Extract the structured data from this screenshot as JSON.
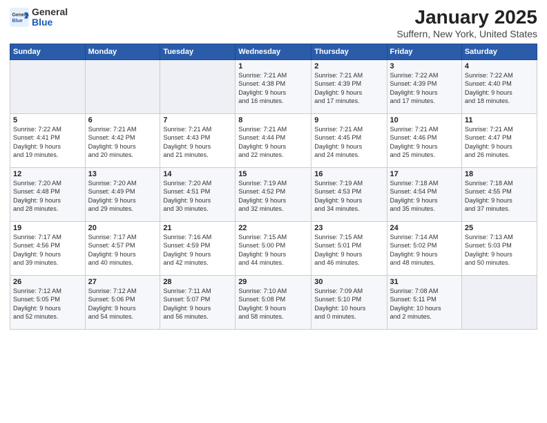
{
  "header": {
    "logo_general": "General",
    "logo_blue": "Blue",
    "title": "January 2025",
    "subtitle": "Suffern, New York, United States"
  },
  "weekdays": [
    "Sunday",
    "Monday",
    "Tuesday",
    "Wednesday",
    "Thursday",
    "Friday",
    "Saturday"
  ],
  "weeks": [
    [
      {
        "day": "",
        "info": ""
      },
      {
        "day": "",
        "info": ""
      },
      {
        "day": "",
        "info": ""
      },
      {
        "day": "1",
        "info": "Sunrise: 7:21 AM\nSunset: 4:38 PM\nDaylight: 9 hours\nand 16 minutes."
      },
      {
        "day": "2",
        "info": "Sunrise: 7:21 AM\nSunset: 4:39 PM\nDaylight: 9 hours\nand 17 minutes."
      },
      {
        "day": "3",
        "info": "Sunrise: 7:22 AM\nSunset: 4:39 PM\nDaylight: 9 hours\nand 17 minutes."
      },
      {
        "day": "4",
        "info": "Sunrise: 7:22 AM\nSunset: 4:40 PM\nDaylight: 9 hours\nand 18 minutes."
      }
    ],
    [
      {
        "day": "5",
        "info": "Sunrise: 7:22 AM\nSunset: 4:41 PM\nDaylight: 9 hours\nand 19 minutes."
      },
      {
        "day": "6",
        "info": "Sunrise: 7:21 AM\nSunset: 4:42 PM\nDaylight: 9 hours\nand 20 minutes."
      },
      {
        "day": "7",
        "info": "Sunrise: 7:21 AM\nSunset: 4:43 PM\nDaylight: 9 hours\nand 21 minutes."
      },
      {
        "day": "8",
        "info": "Sunrise: 7:21 AM\nSunset: 4:44 PM\nDaylight: 9 hours\nand 22 minutes."
      },
      {
        "day": "9",
        "info": "Sunrise: 7:21 AM\nSunset: 4:45 PM\nDaylight: 9 hours\nand 24 minutes."
      },
      {
        "day": "10",
        "info": "Sunrise: 7:21 AM\nSunset: 4:46 PM\nDaylight: 9 hours\nand 25 minutes."
      },
      {
        "day": "11",
        "info": "Sunrise: 7:21 AM\nSunset: 4:47 PM\nDaylight: 9 hours\nand 26 minutes."
      }
    ],
    [
      {
        "day": "12",
        "info": "Sunrise: 7:20 AM\nSunset: 4:48 PM\nDaylight: 9 hours\nand 28 minutes."
      },
      {
        "day": "13",
        "info": "Sunrise: 7:20 AM\nSunset: 4:49 PM\nDaylight: 9 hours\nand 29 minutes."
      },
      {
        "day": "14",
        "info": "Sunrise: 7:20 AM\nSunset: 4:51 PM\nDaylight: 9 hours\nand 30 minutes."
      },
      {
        "day": "15",
        "info": "Sunrise: 7:19 AM\nSunset: 4:52 PM\nDaylight: 9 hours\nand 32 minutes."
      },
      {
        "day": "16",
        "info": "Sunrise: 7:19 AM\nSunset: 4:53 PM\nDaylight: 9 hours\nand 34 minutes."
      },
      {
        "day": "17",
        "info": "Sunrise: 7:18 AM\nSunset: 4:54 PM\nDaylight: 9 hours\nand 35 minutes."
      },
      {
        "day": "18",
        "info": "Sunrise: 7:18 AM\nSunset: 4:55 PM\nDaylight: 9 hours\nand 37 minutes."
      }
    ],
    [
      {
        "day": "19",
        "info": "Sunrise: 7:17 AM\nSunset: 4:56 PM\nDaylight: 9 hours\nand 39 minutes."
      },
      {
        "day": "20",
        "info": "Sunrise: 7:17 AM\nSunset: 4:57 PM\nDaylight: 9 hours\nand 40 minutes."
      },
      {
        "day": "21",
        "info": "Sunrise: 7:16 AM\nSunset: 4:59 PM\nDaylight: 9 hours\nand 42 minutes."
      },
      {
        "day": "22",
        "info": "Sunrise: 7:15 AM\nSunset: 5:00 PM\nDaylight: 9 hours\nand 44 minutes."
      },
      {
        "day": "23",
        "info": "Sunrise: 7:15 AM\nSunset: 5:01 PM\nDaylight: 9 hours\nand 46 minutes."
      },
      {
        "day": "24",
        "info": "Sunrise: 7:14 AM\nSunset: 5:02 PM\nDaylight: 9 hours\nand 48 minutes."
      },
      {
        "day": "25",
        "info": "Sunrise: 7:13 AM\nSunset: 5:03 PM\nDaylight: 9 hours\nand 50 minutes."
      }
    ],
    [
      {
        "day": "26",
        "info": "Sunrise: 7:12 AM\nSunset: 5:05 PM\nDaylight: 9 hours\nand 52 minutes."
      },
      {
        "day": "27",
        "info": "Sunrise: 7:12 AM\nSunset: 5:06 PM\nDaylight: 9 hours\nand 54 minutes."
      },
      {
        "day": "28",
        "info": "Sunrise: 7:11 AM\nSunset: 5:07 PM\nDaylight: 9 hours\nand 56 minutes."
      },
      {
        "day": "29",
        "info": "Sunrise: 7:10 AM\nSunset: 5:08 PM\nDaylight: 9 hours\nand 58 minutes."
      },
      {
        "day": "30",
        "info": "Sunrise: 7:09 AM\nSunset: 5:10 PM\nDaylight: 10 hours\nand 0 minutes."
      },
      {
        "day": "31",
        "info": "Sunrise: 7:08 AM\nSunset: 5:11 PM\nDaylight: 10 hours\nand 2 minutes."
      },
      {
        "day": "",
        "info": ""
      }
    ]
  ]
}
